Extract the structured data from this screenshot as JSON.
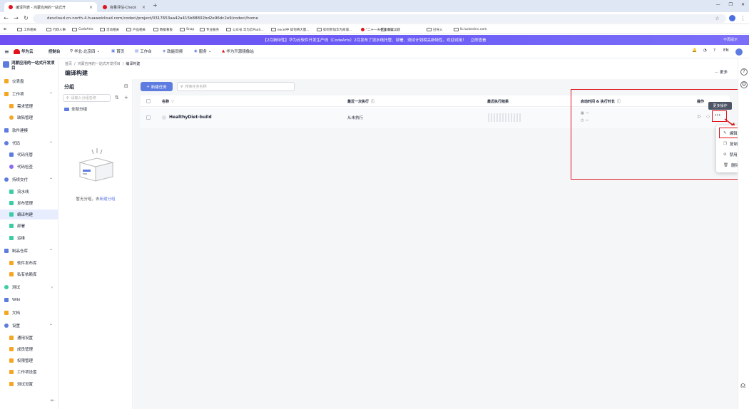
{
  "browser": {
    "tabs": [
      {
        "label": "编译列表 - 鸿蒙应用的一站式开"
      },
      {
        "label": "容量评估-Check"
      }
    ],
    "url": "devcloud.cn-north-4.huaweicloud.com/codeci/project/0317653aa42a415b88802bd2e96dc2e9/codeci/home",
    "bookmarks": [
      "工作相关",
      "行政人事",
      "CodeArts",
      "活动相关",
      "产品相关",
      "数据看板",
      "Snap",
      "专业服务",
      "公众号 华为云PaaS...",
      "excel中 如何将大量...",
      "如何参加华为商城...",
      "\"二十一天养成阅读...",
      "会议议题",
      "已导入",
      "lk.luckeeinc.com"
    ]
  },
  "banner": {
    "text": "【2月新特性】华为云软件开发生产线（CodeArts）2月发布了流水线托管、部署、测试计划相关新特性，欢迎试用！",
    "link": "立即查看",
    "close": "不再提示"
  },
  "header": {
    "brand": "华为云",
    "console": "控制台",
    "region": "华北-北京四",
    "home": "首页",
    "workbench": "工作台",
    "campaign": "政能同频",
    "services": "服务",
    "partner": "华为开源镜像站",
    "lang": "EN"
  },
  "sidebar": {
    "project_name": "鸿蒙应用的一站式开发项目",
    "items": [
      {
        "label": "仪表盘"
      },
      {
        "label": "工作项"
      },
      {
        "label": "需求管理"
      },
      {
        "label": "缺陷管理"
      },
      {
        "label": "软件建模"
      },
      {
        "label": "代码"
      },
      {
        "label": "代码托管"
      },
      {
        "label": "代码检查"
      },
      {
        "label": "持续交付"
      },
      {
        "label": "流水线"
      },
      {
        "label": "发布管理"
      },
      {
        "label": "编译构建"
      },
      {
        "label": "部署"
      },
      {
        "label": "运维"
      },
      {
        "label": "制品仓库"
      },
      {
        "label": "软件发布库"
      },
      {
        "label": "私有依赖库"
      },
      {
        "label": "测试"
      },
      {
        "label": "Wiki"
      },
      {
        "label": "文档"
      },
      {
        "label": "设置"
      },
      {
        "label": "通用设置"
      },
      {
        "label": "成员管理"
      },
      {
        "label": "权限管理"
      },
      {
        "label": "工作项设置"
      },
      {
        "label": "测试设置"
      }
    ]
  },
  "breadcrumb": [
    "首页",
    "鸿蒙应用的一站式开发项目",
    "编译构建"
  ],
  "page_title": "编译构建",
  "more_label": "··· 更多",
  "groups": {
    "title": "分组",
    "search_placeholder": "请输入分组名称",
    "all_groups": "全部分组",
    "empty_text": "暂无分组，去",
    "create_link": "新建分组"
  },
  "toolbar": {
    "new_task": "新建任务",
    "search_placeholder": "搜索任务名称"
  },
  "table": {
    "columns": [
      "名称",
      "最近一次执行",
      "最近执行结果",
      "启动时间 & 执行时长",
      "操作"
    ],
    "rows": [
      {
        "name": "HealthyDiet-build",
        "last_exec": "从未执行",
        "start": "--",
        "duration": "--"
      }
    ]
  },
  "tooltip": "更多操作",
  "menu": [
    "编辑",
    "复制",
    "禁用",
    "删除"
  ],
  "colors": {
    "primary": "#5e7ce0",
    "highlight": "#e0141d",
    "banner": "#6b5cf6"
  }
}
